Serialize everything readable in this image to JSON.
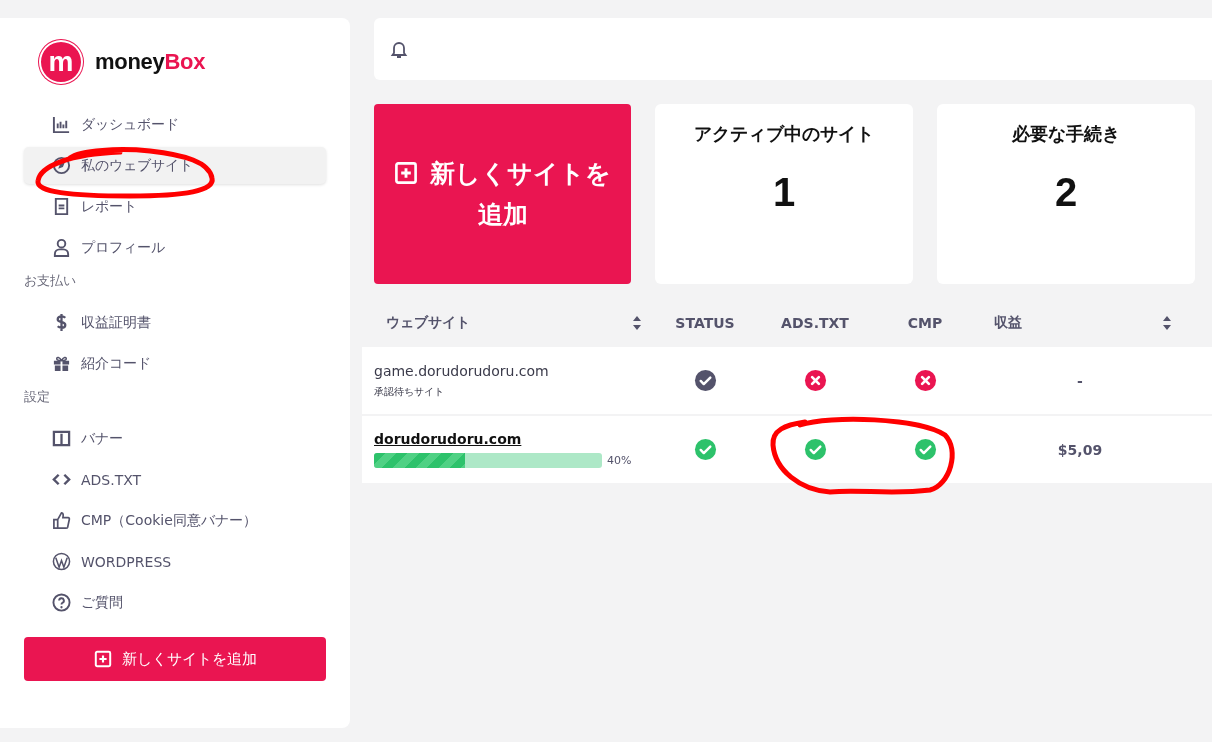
{
  "logo": {
    "mark": "m",
    "name": "money",
    "accent": "Box"
  },
  "nav": [
    {
      "items": [
        {
          "label": "ダッシュボード",
          "selected": false
        },
        {
          "label": "私のウェブサイト",
          "selected": true
        },
        {
          "label": "レポート",
          "selected": false
        },
        {
          "label": "プロフィール",
          "selected": false
        }
      ]
    },
    {
      "heading": "お支払い",
      "items": [
        {
          "label": "収益証明書",
          "selected": false
        },
        {
          "label": "紹介コード",
          "selected": false
        }
      ]
    },
    {
      "heading": "設定",
      "items": [
        {
          "label": "バナー",
          "selected": false
        },
        {
          "label": "ADS.TXT",
          "selected": false
        },
        {
          "label": "CMP（Cookie同意バナー）",
          "selected": false
        },
        {
          "label": "WORDPRESS",
          "selected": false
        },
        {
          "label": "ご質問",
          "selected": false
        }
      ]
    }
  ],
  "sidebar_button": "新しくサイトを追加",
  "add_card": "新しくサイトを追加",
  "stats": [
    {
      "title": "アクティブ中のサイト",
      "value": "1"
    },
    {
      "title": "必要な手続き",
      "value": "2"
    }
  ],
  "table": {
    "columns": [
      {
        "label": "ウェブサイト",
        "sortable": true
      },
      {
        "label": "STATUS",
        "sortable": false
      },
      {
        "label": "ADS.TXT",
        "sortable": false
      },
      {
        "label": "CMP",
        "sortable": false
      },
      {
        "label": "収益",
        "sortable": true
      }
    ],
    "rows": [
      {
        "site": "game.dorudorudoru.com",
        "link": false,
        "note": "承認待ちサイト",
        "cells": [
          {
            "kind": "check",
            "color": "#54536b"
          },
          {
            "kind": "cross",
            "color": "#ea1551"
          },
          {
            "kind": "cross",
            "color": "#ea1551"
          }
        ],
        "revenue": "-"
      },
      {
        "site": "dorudorudoru.com",
        "link": true,
        "progress": {
          "level": 0.4,
          "reading": "40%"
        },
        "cells": [
          {
            "kind": "check",
            "color": "#2dc26b"
          },
          {
            "kind": "check",
            "color": "#2dc26b"
          },
          {
            "kind": "check",
            "color": "#2dc26b"
          }
        ],
        "revenue": "$5,09"
      }
    ]
  }
}
